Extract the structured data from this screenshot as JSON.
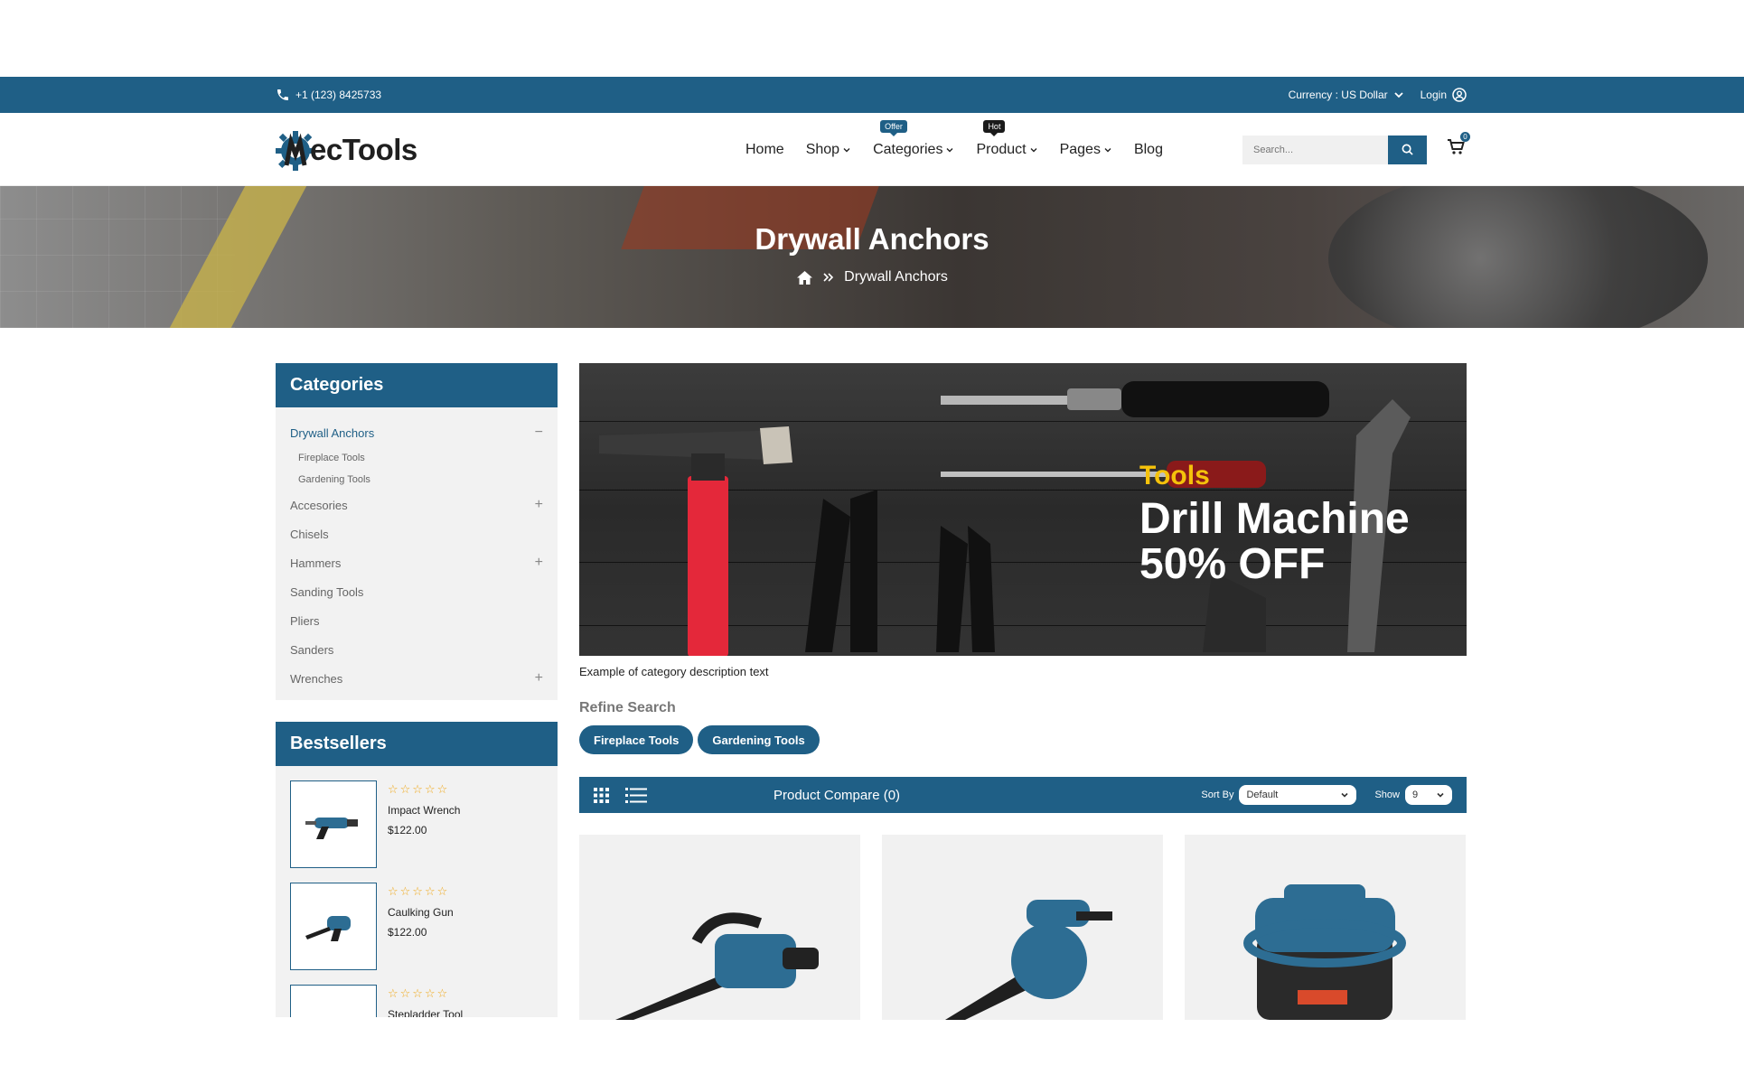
{
  "topbar": {
    "phone": "+1 (123) 8425733",
    "currency": "Currency : US Dollar",
    "login": "Login"
  },
  "header": {
    "logo_text": "MecTools",
    "logo_text_tail": "ecTools",
    "nav": [
      {
        "label": "Home"
      },
      {
        "label": "Shop",
        "dropdown": true
      },
      {
        "label": "Categories",
        "dropdown": true,
        "badge": "Offer"
      },
      {
        "label": "Product",
        "dropdown": true,
        "badge": "Hot"
      },
      {
        "label": "Pages",
        "dropdown": true
      },
      {
        "label": "Blog"
      }
    ],
    "search_placeholder": "Search...",
    "cart_count": "0"
  },
  "hero": {
    "title": "Drywall Anchors",
    "breadcrumb_current": "Drywall Anchors"
  },
  "sidebar": {
    "categories_title": "Categories",
    "categories": [
      {
        "label": "Drywall Anchors",
        "toggle": "−",
        "active": true,
        "children": [
          "Fireplace Tools",
          "Gardening Tools"
        ]
      },
      {
        "label": "Accesories",
        "toggle": "+"
      },
      {
        "label": "Chisels",
        "toggle": ""
      },
      {
        "label": "Hammers",
        "toggle": "+"
      },
      {
        "label": "Sanding Tools",
        "toggle": ""
      },
      {
        "label": "Pliers",
        "toggle": ""
      },
      {
        "label": "Sanders",
        "toggle": ""
      },
      {
        "label": "Wrenches",
        "toggle": "+"
      }
    ],
    "bestsellers_title": "Bestsellers",
    "bestsellers": [
      {
        "name": "Impact Wrench",
        "price": "$122.00",
        "stars": "☆☆☆☆☆"
      },
      {
        "name": "Caulking Gun",
        "price": "$122.00",
        "stars": "☆☆☆☆☆"
      },
      {
        "name": "Stepladder Tool",
        "price": "",
        "stars": "☆☆☆☆☆"
      }
    ]
  },
  "main": {
    "banner_sub": "Tools",
    "banner_line1": "Drill Machine",
    "banner_line2": "50% OFF",
    "description": "Example of category description text",
    "refine_title": "Refine Search",
    "refine_chips": [
      "Fireplace Tools",
      "Gardening Tools"
    ],
    "toolbar": {
      "compare": "Product Compare (0)",
      "sort_label": "Sort By",
      "sort_value": "Default",
      "show_label": "Show",
      "show_value": "9"
    }
  },
  "colors": {
    "primary": "#1f5f86",
    "accent_yellow": "#f5c20b",
    "star": "#f0a818",
    "panel_bg": "#f2f2f2"
  }
}
